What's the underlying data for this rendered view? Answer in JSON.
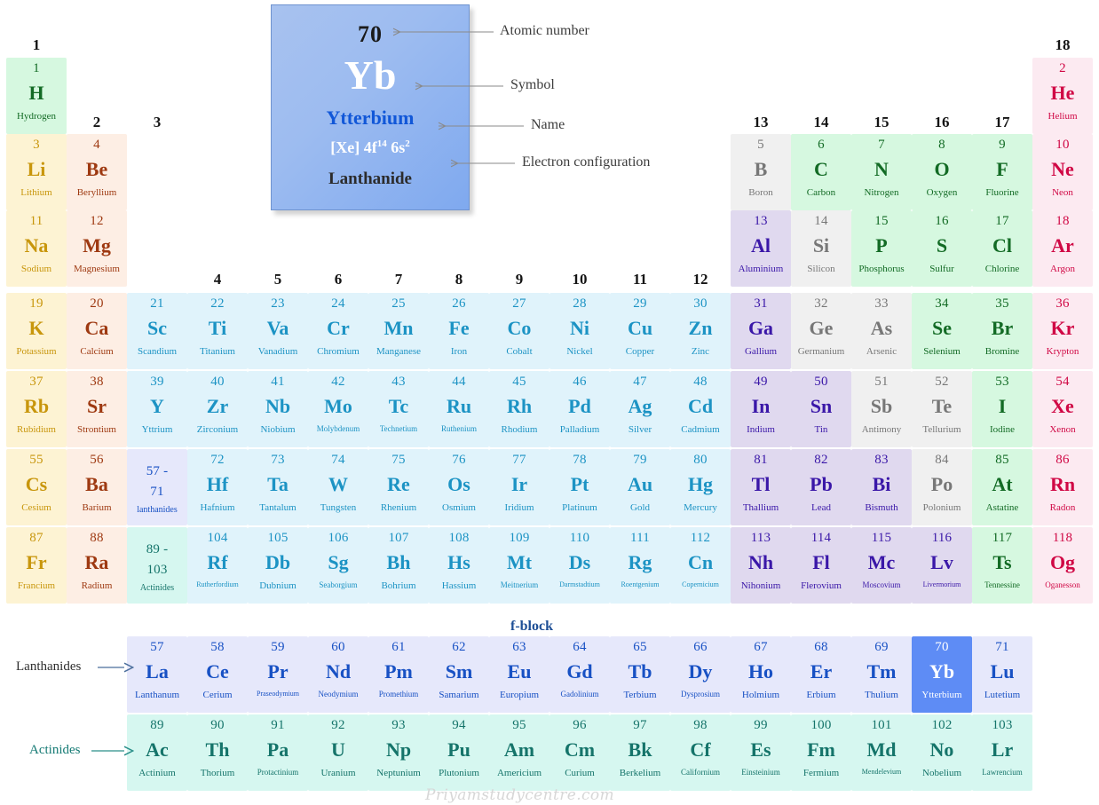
{
  "key_card": {
    "atomic_number": "70",
    "symbol": "Yb",
    "name": "Ytterbium",
    "config_prefix": "[Xe] 4f",
    "config_sup1": "14",
    "config_mid": " 6s",
    "config_sup2": "2",
    "category": "Lanthanide"
  },
  "callouts": {
    "atomic_number": "Atomic number",
    "symbol": "Symbol",
    "name": "Name",
    "electron_configuration": "Electron configuration"
  },
  "labels": {
    "fblock": "f-block",
    "lanthanides": "Lanthanides",
    "actinides": "Actinides",
    "watermark": "Priyamstudycentre.com"
  },
  "group_numbers": [
    "1",
    "2",
    "3",
    "4",
    "5",
    "6",
    "7",
    "8",
    "9",
    "10",
    "11",
    "12",
    "13",
    "14",
    "15",
    "16",
    "17",
    "18"
  ],
  "colors": {
    "alkali_bg": "#fdf3d3",
    "alkali_fg": "#c8960c",
    "alkaline_bg": "#fdeee4",
    "alkaline_fg": "#9e3911",
    "transition_bg": "#e0f3fb",
    "transition_fg": "#1c93c4",
    "posttransition_bg": "#e0d9ef",
    "posttransition_fg": "#3a17a8",
    "metalloid_bg": "#f0f0f0",
    "metalloid_fg": "#777777",
    "nonmetal_bg": "#d6f8e0",
    "nonmetal_fg": "#136b25",
    "noble_bg": "#fceaf1",
    "noble_fg": "#d00845",
    "lanthanide_bg": "#e6e8fb",
    "lanthanide_fg": "#1851c4",
    "actinide_bg": "#d6f7f0",
    "actinide_fg": "#15746a",
    "highlight_bg": "#5e8cf5",
    "highlight_fg": "#ffffff"
  },
  "elements": [
    {
      "z": "1",
      "sym": "H",
      "name": "Hydrogen",
      "cat": "nonmetal",
      "g": 1,
      "p": 1
    },
    {
      "z": "2",
      "sym": "He",
      "name": "Helium",
      "cat": "noble",
      "g": 18,
      "p": 1
    },
    {
      "z": "3",
      "sym": "Li",
      "name": "Lithium",
      "cat": "alkali",
      "g": 1,
      "p": 2
    },
    {
      "z": "4",
      "sym": "Be",
      "name": "Beryllium",
      "cat": "alkaline",
      "g": 2,
      "p": 2
    },
    {
      "z": "5",
      "sym": "B",
      "name": "Boron",
      "cat": "metalloid",
      "g": 13,
      "p": 2
    },
    {
      "z": "6",
      "sym": "C",
      "name": "Carbon",
      "cat": "nonmetal",
      "g": 14,
      "p": 2
    },
    {
      "z": "7",
      "sym": "N",
      "name": "Nitrogen",
      "cat": "nonmetal",
      "g": 15,
      "p": 2
    },
    {
      "z": "8",
      "sym": "O",
      "name": "Oxygen",
      "cat": "nonmetal",
      "g": 16,
      "p": 2
    },
    {
      "z": "9",
      "sym": "F",
      "name": "Fluorine",
      "cat": "nonmetal",
      "g": 17,
      "p": 2
    },
    {
      "z": "10",
      "sym": "Ne",
      "name": "Neon",
      "cat": "noble",
      "g": 18,
      "p": 2
    },
    {
      "z": "11",
      "sym": "Na",
      "name": "Sodium",
      "cat": "alkali",
      "g": 1,
      "p": 3
    },
    {
      "z": "12",
      "sym": "Mg",
      "name": "Magnesium",
      "cat": "alkaline",
      "g": 2,
      "p": 3
    },
    {
      "z": "13",
      "sym": "Al",
      "name": "Aluminium",
      "cat": "posttrans",
      "g": 13,
      "p": 3
    },
    {
      "z": "14",
      "sym": "Si",
      "name": "Silicon",
      "cat": "metalloid",
      "g": 14,
      "p": 3
    },
    {
      "z": "15",
      "sym": "P",
      "name": "Phosphorus",
      "cat": "nonmetal",
      "g": 15,
      "p": 3
    },
    {
      "z": "16",
      "sym": "S",
      "name": "Sulfur",
      "cat": "nonmetal",
      "g": 16,
      "p": 3
    },
    {
      "z": "17",
      "sym": "Cl",
      "name": "Chlorine",
      "cat": "nonmetal",
      "g": 17,
      "p": 3
    },
    {
      "z": "18",
      "sym": "Ar",
      "name": "Argon",
      "cat": "noble",
      "g": 18,
      "p": 3
    },
    {
      "z": "19",
      "sym": "K",
      "name": "Potassium",
      "cat": "alkali",
      "g": 1,
      "p": 4
    },
    {
      "z": "20",
      "sym": "Ca",
      "name": "Calcium",
      "cat": "alkaline",
      "g": 2,
      "p": 4
    },
    {
      "z": "21",
      "sym": "Sc",
      "name": "Scandium",
      "cat": "transition",
      "g": 3,
      "p": 4
    },
    {
      "z": "22",
      "sym": "Ti",
      "name": "Titanium",
      "cat": "transition",
      "g": 4,
      "p": 4
    },
    {
      "z": "23",
      "sym": "Va",
      "name": "Vanadium",
      "cat": "transition",
      "g": 5,
      "p": 4
    },
    {
      "z": "24",
      "sym": "Cr",
      "name": "Chromium",
      "cat": "transition",
      "g": 6,
      "p": 4
    },
    {
      "z": "25",
      "sym": "Mn",
      "name": "Manganese",
      "cat": "transition",
      "g": 7,
      "p": 4
    },
    {
      "z": "26",
      "sym": "Fe",
      "name": "Iron",
      "cat": "transition",
      "g": 8,
      "p": 4
    },
    {
      "z": "27",
      "sym": "Co",
      "name": "Cobalt",
      "cat": "transition",
      "g": 9,
      "p": 4
    },
    {
      "z": "28",
      "sym": "Ni",
      "name": "Nickel",
      "cat": "transition",
      "g": 10,
      "p": 4
    },
    {
      "z": "29",
      "sym": "Cu",
      "name": "Copper",
      "cat": "transition",
      "g": 11,
      "p": 4
    },
    {
      "z": "30",
      "sym": "Zn",
      "name": "Zinc",
      "cat": "transition",
      "g": 12,
      "p": 4
    },
    {
      "z": "31",
      "sym": "Ga",
      "name": "Gallium",
      "cat": "posttrans",
      "g": 13,
      "p": 4
    },
    {
      "z": "32",
      "sym": "Ge",
      "name": "Germanium",
      "cat": "metalloid",
      "g": 14,
      "p": 4
    },
    {
      "z": "33",
      "sym": "As",
      "name": "Arsenic",
      "cat": "metalloid",
      "g": 15,
      "p": 4
    },
    {
      "z": "34",
      "sym": "Se",
      "name": "Selenium",
      "cat": "nonmetal",
      "g": 16,
      "p": 4
    },
    {
      "z": "35",
      "sym": "Br",
      "name": "Bromine",
      "cat": "nonmetal",
      "g": 17,
      "p": 4
    },
    {
      "z": "36",
      "sym": "Kr",
      "name": "Krypton",
      "cat": "noble",
      "g": 18,
      "p": 4
    },
    {
      "z": "37",
      "sym": "Rb",
      "name": "Rubidium",
      "cat": "alkali",
      "g": 1,
      "p": 5
    },
    {
      "z": "38",
      "sym": "Sr",
      "name": "Strontium",
      "cat": "alkaline",
      "g": 2,
      "p": 5
    },
    {
      "z": "39",
      "sym": "Y",
      "name": "Yttrium",
      "cat": "transition",
      "g": 3,
      "p": 5
    },
    {
      "z": "40",
      "sym": "Zr",
      "name": "Zirconium",
      "cat": "transition",
      "g": 4,
      "p": 5
    },
    {
      "z": "41",
      "sym": "Nb",
      "name": "Niobium",
      "cat": "transition",
      "g": 5,
      "p": 5
    },
    {
      "z": "42",
      "sym": "Mo",
      "name": "Molybdenum",
      "cat": "transition",
      "g": 6,
      "p": 5,
      "small": 1
    },
    {
      "z": "43",
      "sym": "Tc",
      "name": "Technetium",
      "cat": "transition",
      "g": 7,
      "p": 5,
      "small": 1
    },
    {
      "z": "44",
      "sym": "Ru",
      "name": "Ruthenium",
      "cat": "transition",
      "g": 8,
      "p": 5,
      "small": 1
    },
    {
      "z": "45",
      "sym": "Rh",
      "name": "Rhodium",
      "cat": "transition",
      "g": 9,
      "p": 5
    },
    {
      "z": "46",
      "sym": "Pd",
      "name": "Palladium",
      "cat": "transition",
      "g": 10,
      "p": 5
    },
    {
      "z": "47",
      "sym": "Ag",
      "name": "Silver",
      "cat": "transition",
      "g": 11,
      "p": 5
    },
    {
      "z": "48",
      "sym": "Cd",
      "name": "Cadmium",
      "cat": "transition",
      "g": 12,
      "p": 5
    },
    {
      "z": "49",
      "sym": "In",
      "name": "Indium",
      "cat": "posttrans",
      "g": 13,
      "p": 5
    },
    {
      "z": "50",
      "sym": "Sn",
      "name": "Tin",
      "cat": "posttrans",
      "g": 14,
      "p": 5
    },
    {
      "z": "51",
      "sym": "Sb",
      "name": "Antimony",
      "cat": "metalloid",
      "g": 15,
      "p": 5
    },
    {
      "z": "52",
      "sym": "Te",
      "name": "Tellurium",
      "cat": "metalloid",
      "g": 16,
      "p": 5
    },
    {
      "z": "53",
      "sym": "I",
      "name": "Iodine",
      "cat": "nonmetal",
      "g": 17,
      "p": 5
    },
    {
      "z": "54",
      "sym": "Xe",
      "name": "Xenon",
      "cat": "noble",
      "g": 18,
      "p": 5
    },
    {
      "z": "55",
      "sym": "Cs",
      "name": "Cesium",
      "cat": "alkali",
      "g": 1,
      "p": 6
    },
    {
      "z": "56",
      "sym": "Ba",
      "name": "Barium",
      "cat": "alkaline",
      "g": 2,
      "p": 6
    },
    {
      "z": "72",
      "sym": "Hf",
      "name": "Hafnium",
      "cat": "transition",
      "g": 4,
      "p": 6
    },
    {
      "z": "73",
      "sym": "Ta",
      "name": "Tantalum",
      "cat": "transition",
      "g": 5,
      "p": 6
    },
    {
      "z": "74",
      "sym": "W",
      "name": "Tungsten",
      "cat": "transition",
      "g": 6,
      "p": 6
    },
    {
      "z": "75",
      "sym": "Re",
      "name": "Rhenium",
      "cat": "transition",
      "g": 7,
      "p": 6
    },
    {
      "z": "76",
      "sym": "Os",
      "name": "Osmium",
      "cat": "transition",
      "g": 8,
      "p": 6
    },
    {
      "z": "77",
      "sym": "Ir",
      "name": "Iridium",
      "cat": "transition",
      "g": 9,
      "p": 6
    },
    {
      "z": "78",
      "sym": "Pt",
      "name": "Platinum",
      "cat": "transition",
      "g": 10,
      "p": 6
    },
    {
      "z": "79",
      "sym": "Au",
      "name": "Gold",
      "cat": "transition",
      "g": 11,
      "p": 6
    },
    {
      "z": "80",
      "sym": "Hg",
      "name": "Mercury",
      "cat": "transition",
      "g": 12,
      "p": 6
    },
    {
      "z": "81",
      "sym": "Tl",
      "name": "Thallium",
      "cat": "posttrans",
      "g": 13,
      "p": 6
    },
    {
      "z": "82",
      "sym": "Pb",
      "name": "Lead",
      "cat": "posttrans",
      "g": 14,
      "p": 6
    },
    {
      "z": "83",
      "sym": "Bi",
      "name": "Bismuth",
      "cat": "posttrans",
      "g": 15,
      "p": 6
    },
    {
      "z": "84",
      "sym": "Po",
      "name": "Polonium",
      "cat": "metalloid",
      "g": 16,
      "p": 6
    },
    {
      "z": "85",
      "sym": "At",
      "name": "Astatine",
      "cat": "nonmetal",
      "g": 17,
      "p": 6
    },
    {
      "z": "86",
      "sym": "Rn",
      "name": "Radon",
      "cat": "noble",
      "g": 18,
      "p": 6
    },
    {
      "z": "87",
      "sym": "Fr",
      "name": "Francium",
      "cat": "alkali",
      "g": 1,
      "p": 7
    },
    {
      "z": "88",
      "sym": "Ra",
      "name": "Radium",
      "cat": "alkaline",
      "g": 2,
      "p": 7
    },
    {
      "z": "104",
      "sym": "Rf",
      "name": "Rutherfordium",
      "cat": "transition",
      "g": 4,
      "p": 7,
      "tiny": 1
    },
    {
      "z": "105",
      "sym": "Db",
      "name": "Dubnium",
      "cat": "transition",
      "g": 5,
      "p": 7
    },
    {
      "z": "106",
      "sym": "Sg",
      "name": "Seaborgium",
      "cat": "transition",
      "g": 6,
      "p": 7,
      "small": 1
    },
    {
      "z": "107",
      "sym": "Bh",
      "name": "Bohrium",
      "cat": "transition",
      "g": 7,
      "p": 7
    },
    {
      "z": "108",
      "sym": "Hs",
      "name": "Hassium",
      "cat": "transition",
      "g": 8,
      "p": 7
    },
    {
      "z": "109",
      "sym": "Mt",
      "name": "Meitnerium",
      "cat": "transition",
      "g": 9,
      "p": 7,
      "small": 1
    },
    {
      "z": "110",
      "sym": "Ds",
      "name": "Darmstadtium",
      "cat": "transition",
      "g": 10,
      "p": 7,
      "tiny": 1
    },
    {
      "z": "111",
      "sym": "Rg",
      "name": "Roentgenium",
      "cat": "transition",
      "g": 11,
      "p": 7,
      "tiny": 1
    },
    {
      "z": "112",
      "sym": "Cn",
      "name": "Copernicium",
      "cat": "transition",
      "g": 12,
      "p": 7,
      "tiny": 1
    },
    {
      "z": "113",
      "sym": "Nh",
      "name": "Nihonium",
      "cat": "posttrans",
      "g": 13,
      "p": 7
    },
    {
      "z": "114",
      "sym": "Fl",
      "name": "Flerovium",
      "cat": "posttrans",
      "g": 14,
      "p": 7
    },
    {
      "z": "115",
      "sym": "Mc",
      "name": "Moscovium",
      "cat": "posttrans",
      "g": 15,
      "p": 7,
      "small": 1
    },
    {
      "z": "116",
      "sym": "Lv",
      "name": "Livermorium",
      "cat": "posttrans",
      "g": 16,
      "p": 7,
      "tiny": 1
    },
    {
      "z": "117",
      "sym": "Ts",
      "name": "Tennessine",
      "cat": "nonmetal",
      "g": 17,
      "p": 7,
      "small": 1
    },
    {
      "z": "118",
      "sym": "Og",
      "name": "Oganesson",
      "cat": "noble",
      "g": 18,
      "p": 7,
      "small": 1
    }
  ],
  "placeholders": [
    {
      "z": "57 -",
      "z2": "71",
      "name": "lanthanides",
      "cat": "lanthanide",
      "g": 3,
      "p": 6
    },
    {
      "z": "89 -",
      "z2": "103",
      "name": "Actinides",
      "cat": "actinide",
      "g": 3,
      "p": 7
    }
  ],
  "lanthanide_row": [
    {
      "z": "57",
      "sym": "La",
      "name": "Lanthanum"
    },
    {
      "z": "58",
      "sym": "Ce",
      "name": "Cerium"
    },
    {
      "z": "59",
      "sym": "Pr",
      "name": "Praseodymium",
      "tiny": 1
    },
    {
      "z": "60",
      "sym": "Nd",
      "name": "Neodymium",
      "small": 1
    },
    {
      "z": "61",
      "sym": "Pm",
      "name": "Promethium",
      "small": 1
    },
    {
      "z": "62",
      "sym": "Sm",
      "name": "Samarium"
    },
    {
      "z": "63",
      "sym": "Eu",
      "name": "Europium"
    },
    {
      "z": "64",
      "sym": "Gd",
      "name": "Gadolinium",
      "small": 1
    },
    {
      "z": "65",
      "sym": "Tb",
      "name": "Terbium"
    },
    {
      "z": "66",
      "sym": "Dy",
      "name": "Dysprosium",
      "small": 1
    },
    {
      "z": "67",
      "sym": "Ho",
      "name": "Holmium"
    },
    {
      "z": "68",
      "sym": "Er",
      "name": "Erbium"
    },
    {
      "z": "69",
      "sym": "Tm",
      "name": "Thulium"
    },
    {
      "z": "70",
      "sym": "Yb",
      "name": "Ytterbium",
      "highlight": 1
    },
    {
      "z": "71",
      "sym": "Lu",
      "name": "Lutetium"
    }
  ],
  "actinide_row": [
    {
      "z": "89",
      "sym": "Ac",
      "name": "Actinium"
    },
    {
      "z": "90",
      "sym": "Th",
      "name": "Thorium"
    },
    {
      "z": "91",
      "sym": "Pa",
      "name": "Protactinium",
      "small": 1
    },
    {
      "z": "92",
      "sym": "U",
      "name": "Uranium"
    },
    {
      "z": "93",
      "sym": "Np",
      "name": "Neptunium"
    },
    {
      "z": "94",
      "sym": "Pu",
      "name": "Plutonium"
    },
    {
      "z": "95",
      "sym": "Am",
      "name": "Americium"
    },
    {
      "z": "96",
      "sym": "Cm",
      "name": "Curium"
    },
    {
      "z": "97",
      "sym": "Bk",
      "name": "Berkelium"
    },
    {
      "z": "98",
      "sym": "Cf",
      "name": "Californium",
      "small": 1
    },
    {
      "z": "99",
      "sym": "Es",
      "name": "Einsteinium",
      "small": 1
    },
    {
      "z": "100",
      "sym": "Fm",
      "name": "Fermium"
    },
    {
      "z": "101",
      "sym": "Md",
      "name": "Mendelevium",
      "tiny": 1
    },
    {
      "z": "102",
      "sym": "No",
      "name": "Nobelium"
    },
    {
      "z": "103",
      "sym": "Lr",
      "name": "Lawrencium",
      "small": 1
    }
  ]
}
